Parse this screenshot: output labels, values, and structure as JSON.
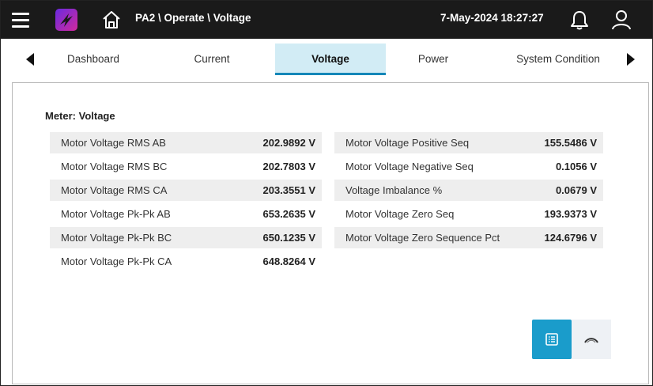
{
  "header": {
    "breadcrumb": "PA2 \\ Operate \\ Voltage",
    "datetime": "7-May-2024 18:27:27",
    "icons": [
      "menu-icon",
      "app-logo-icon",
      "home-icon",
      "bell-icon",
      "user-icon"
    ]
  },
  "tabs": [
    {
      "label": "Dashboard",
      "active": false
    },
    {
      "label": "Current",
      "active": false
    },
    {
      "label": "Voltage",
      "active": true
    },
    {
      "label": "Power",
      "active": false
    },
    {
      "label": "System Condition",
      "active": false
    }
  ],
  "meter": {
    "title": "Meter: Voltage",
    "left": [
      {
        "label": "Motor Voltage RMS AB",
        "value": "202.9892 V"
      },
      {
        "label": "Motor Voltage RMS BC",
        "value": "202.7803 V"
      },
      {
        "label": "Motor Voltage RMS CA",
        "value": "203.3551 V"
      },
      {
        "label": "Motor Voltage Pk-Pk AB",
        "value": "653.2635 V"
      },
      {
        "label": "Motor Voltage Pk-Pk BC",
        "value": "650.1235 V"
      },
      {
        "label": "Motor Voltage Pk-Pk CA",
        "value": "648.8264 V"
      }
    ],
    "right": [
      {
        "label": "Motor Voltage Positive Seq",
        "value": "155.5486 V"
      },
      {
        "label": "Motor Voltage Negative Seq",
        "value": "0.1056 V"
      },
      {
        "label": "Voltage Imbalance %",
        "value": "0.0679 V"
      },
      {
        "label": "Motor Voltage Zero Seq",
        "value": "193.9373 V"
      },
      {
        "label": "Motor Voltage Zero Sequence Pct",
        "value": "124.6796 V"
      }
    ]
  },
  "view_buttons": {
    "list_view": {
      "icon": "list-view-icon",
      "active": true
    },
    "gauge_view": {
      "icon": "gauge-view-icon",
      "active": false
    }
  },
  "colors": {
    "topbar": "#1a1a1a",
    "accent": "#1a9ccb",
    "active_tab_bg": "#d2ecf5",
    "row_shade": "#eeeeee",
    "logo_purple": "#7a2ad8",
    "logo_magenta": "#c02aa8"
  }
}
